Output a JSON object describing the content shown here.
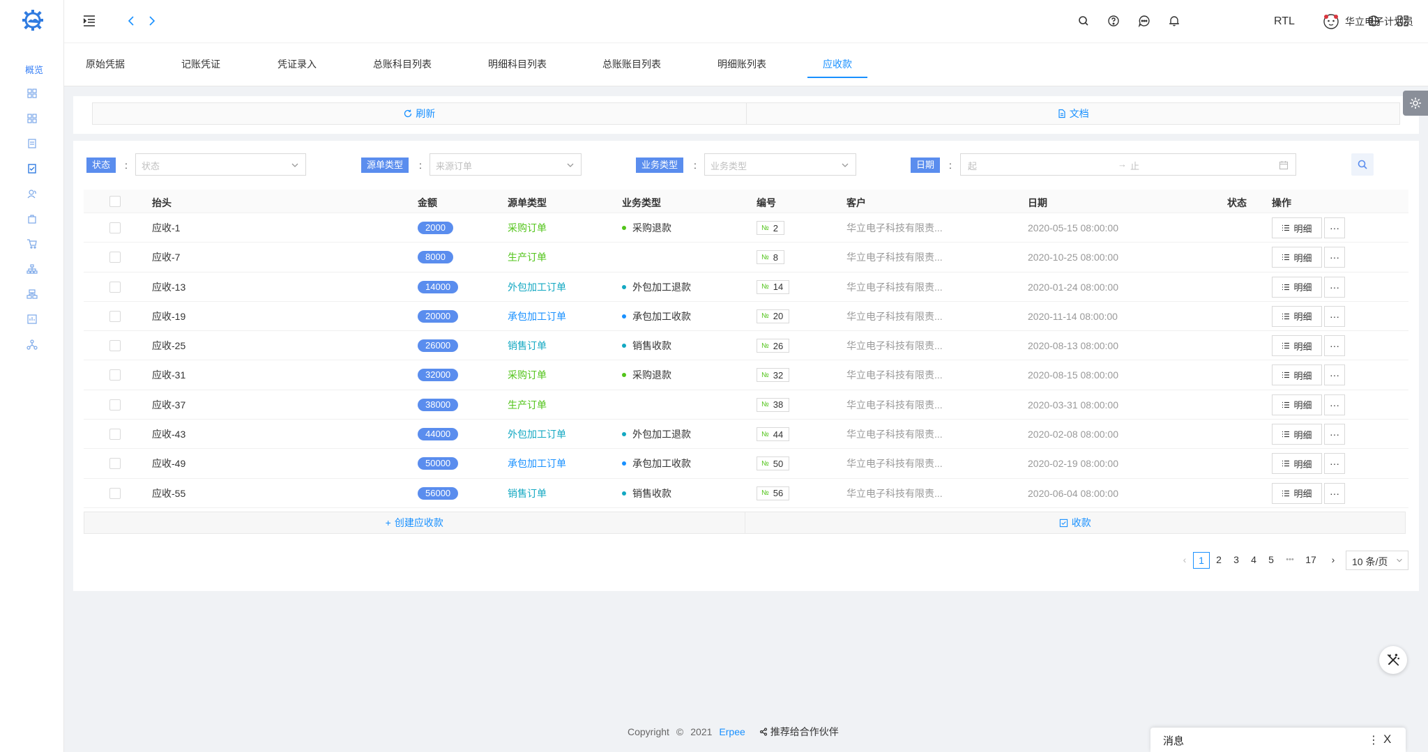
{
  "sidebar": {
    "overview_label": "概览",
    "icons": [
      "grid-icon",
      "grid-icon",
      "document-icon",
      "checklist-icon",
      "users-icon",
      "bag-icon",
      "cart-icon",
      "org-icon",
      "sitemap-icon",
      "report-icon",
      "network-icon"
    ]
  },
  "header": {
    "rtl_label": "RTL",
    "user_name": "华立电子计划员"
  },
  "tabs": [
    {
      "label": "原始凭据"
    },
    {
      "label": "记账凭证"
    },
    {
      "label": "凭证录入"
    },
    {
      "label": "总账科目列表"
    },
    {
      "label": "明细科目列表"
    },
    {
      "label": "总账账目列表"
    },
    {
      "label": "明细账列表"
    },
    {
      "label": "应收款",
      "active": true
    }
  ],
  "toolbar": {
    "refresh_label": "刷新",
    "docs_label": "文档"
  },
  "filters": {
    "status": {
      "label": "状态",
      "placeholder": "状态"
    },
    "source_type": {
      "label": "源单类型",
      "placeholder": "来源订单"
    },
    "business_type": {
      "label": "业务类型",
      "placeholder": "业务类型"
    },
    "date": {
      "label": "日期",
      "start_placeholder": "起",
      "end_placeholder": "止"
    },
    "separator": ":"
  },
  "table": {
    "columns": {
      "title": "抬头",
      "amount": "金额",
      "source_type": "源单类型",
      "business_type": "业务类型",
      "number": "编号",
      "customer": "客户",
      "date": "日期",
      "status": "状态",
      "actions": "操作"
    },
    "number_prefix": "№",
    "detail_label": "明细",
    "rows": [
      {
        "title": "应收-1",
        "amount": "2000",
        "source_type": "采购订单",
        "source_color": "#52c41a",
        "business_type": "采购退款",
        "biz_color": "#52c41a",
        "number": "2",
        "customer": "华立电子科技有限责...",
        "date": "2020-05-15 08:00:00"
      },
      {
        "title": "应收-7",
        "amount": "8000",
        "source_type": "生产订单",
        "source_color": "#52c41a",
        "business_type": "",
        "biz_color": "",
        "number": "8",
        "customer": "华立电子科技有限责...",
        "date": "2020-10-25 08:00:00"
      },
      {
        "title": "应收-13",
        "amount": "14000",
        "source_type": "外包加工订单",
        "source_color": "#13a8c2",
        "business_type": "外包加工退款",
        "biz_color": "#13a8c2",
        "number": "14",
        "customer": "华立电子科技有限责...",
        "date": "2020-01-24 08:00:00"
      },
      {
        "title": "应收-19",
        "amount": "20000",
        "source_type": "承包加工订单",
        "source_color": "#1890ff",
        "business_type": "承包加工收款",
        "biz_color": "#1890ff",
        "number": "20",
        "customer": "华立电子科技有限责...",
        "date": "2020-11-14 08:00:00"
      },
      {
        "title": "应收-25",
        "amount": "26000",
        "source_type": "销售订单",
        "source_color": "#13a8c2",
        "business_type": "销售收款",
        "biz_color": "#13a8c2",
        "number": "26",
        "customer": "华立电子科技有限责...",
        "date": "2020-08-13 08:00:00"
      },
      {
        "title": "应收-31",
        "amount": "32000",
        "source_type": "采购订单",
        "source_color": "#52c41a",
        "business_type": "采购退款",
        "biz_color": "#52c41a",
        "number": "32",
        "customer": "华立电子科技有限责...",
        "date": "2020-08-15 08:00:00"
      },
      {
        "title": "应收-37",
        "amount": "38000",
        "source_type": "生产订单",
        "source_color": "#52c41a",
        "business_type": "",
        "biz_color": "",
        "number": "38",
        "customer": "华立电子科技有限责...",
        "date": "2020-03-31 08:00:00"
      },
      {
        "title": "应收-43",
        "amount": "44000",
        "source_type": "外包加工订单",
        "source_color": "#13a8c2",
        "business_type": "外包加工退款",
        "biz_color": "#13a8c2",
        "number": "44",
        "customer": "华立电子科技有限责...",
        "date": "2020-02-08 08:00:00"
      },
      {
        "title": "应收-49",
        "amount": "50000",
        "source_type": "承包加工订单",
        "source_color": "#1890ff",
        "business_type": "承包加工收款",
        "biz_color": "#1890ff",
        "number": "50",
        "customer": "华立电子科技有限责...",
        "date": "2020-02-19 08:00:00"
      },
      {
        "title": "应收-55",
        "amount": "56000",
        "source_type": "销售订单",
        "source_color": "#13a8c2",
        "business_type": "销售收款",
        "biz_color": "#13a8c2",
        "number": "56",
        "customer": "华立电子科技有限责...",
        "date": "2020-06-04 08:00:00"
      }
    ]
  },
  "table_actions": {
    "create_label": "创建应收款",
    "collect_label": "收款"
  },
  "pagination": {
    "pages": [
      "1",
      "2",
      "3",
      "4",
      "5"
    ],
    "ellipsis": "•••",
    "last_page": "17",
    "current": "1",
    "page_size": "10 条/页"
  },
  "footer": {
    "copyright": "Copyright",
    "copyright_symbol": "©",
    "year": "2021",
    "brand": "Erpee",
    "partner_label": "推荐给合作伙伴"
  },
  "message_panel": {
    "title": "消息",
    "more": "⋮",
    "close": "X"
  },
  "colors": {
    "primary": "#1890ff",
    "label_bg": "#5a8dee",
    "amount_bg": "#5a8dee",
    "page_bg": "#f0f2f5"
  }
}
